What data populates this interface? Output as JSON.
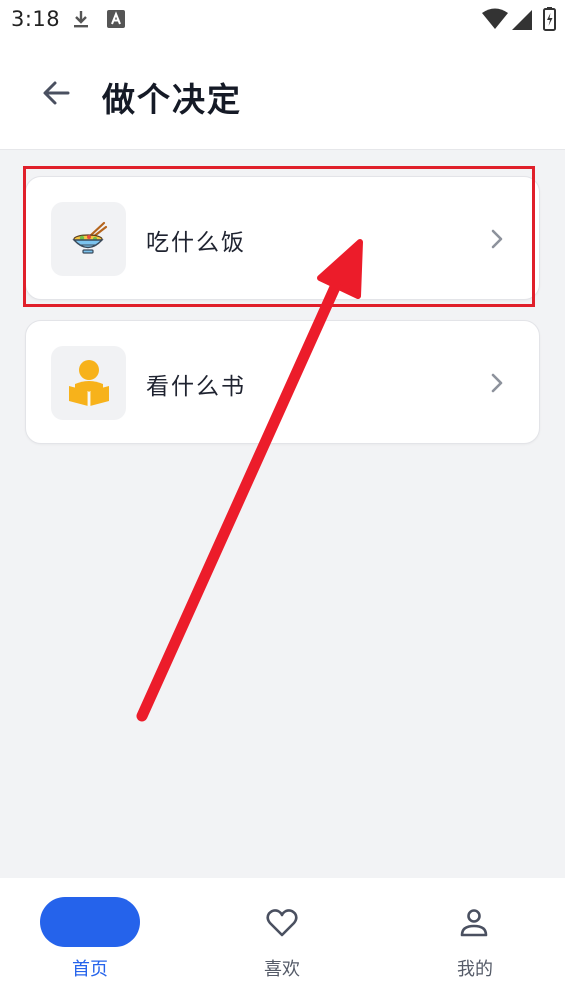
{
  "status_bar": {
    "time": "3:18",
    "icons": [
      "download-icon",
      "a-notification-icon",
      "wifi-icon",
      "signal-icon",
      "battery-icon"
    ]
  },
  "header": {
    "title": "做个决定",
    "back_icon": "arrow-left-icon"
  },
  "cards": [
    {
      "label": "吃什么饭",
      "icon": "noodle-bowl-icon",
      "chevron": "chevron-right-icon"
    },
    {
      "label": "看什么书",
      "icon": "person-reading-icon",
      "chevron": "chevron-right-icon"
    }
  ],
  "bottom_nav": {
    "items": [
      {
        "label": "首页",
        "icon": "home-pill",
        "active": true
      },
      {
        "label": "喜欢",
        "icon": "heart-icon",
        "active": false
      },
      {
        "label": "我的",
        "icon": "user-icon",
        "active": false
      }
    ]
  },
  "colors": {
    "accent": "#2563eb",
    "annotation": "#e01f2a",
    "background": "#f2f3f5"
  }
}
